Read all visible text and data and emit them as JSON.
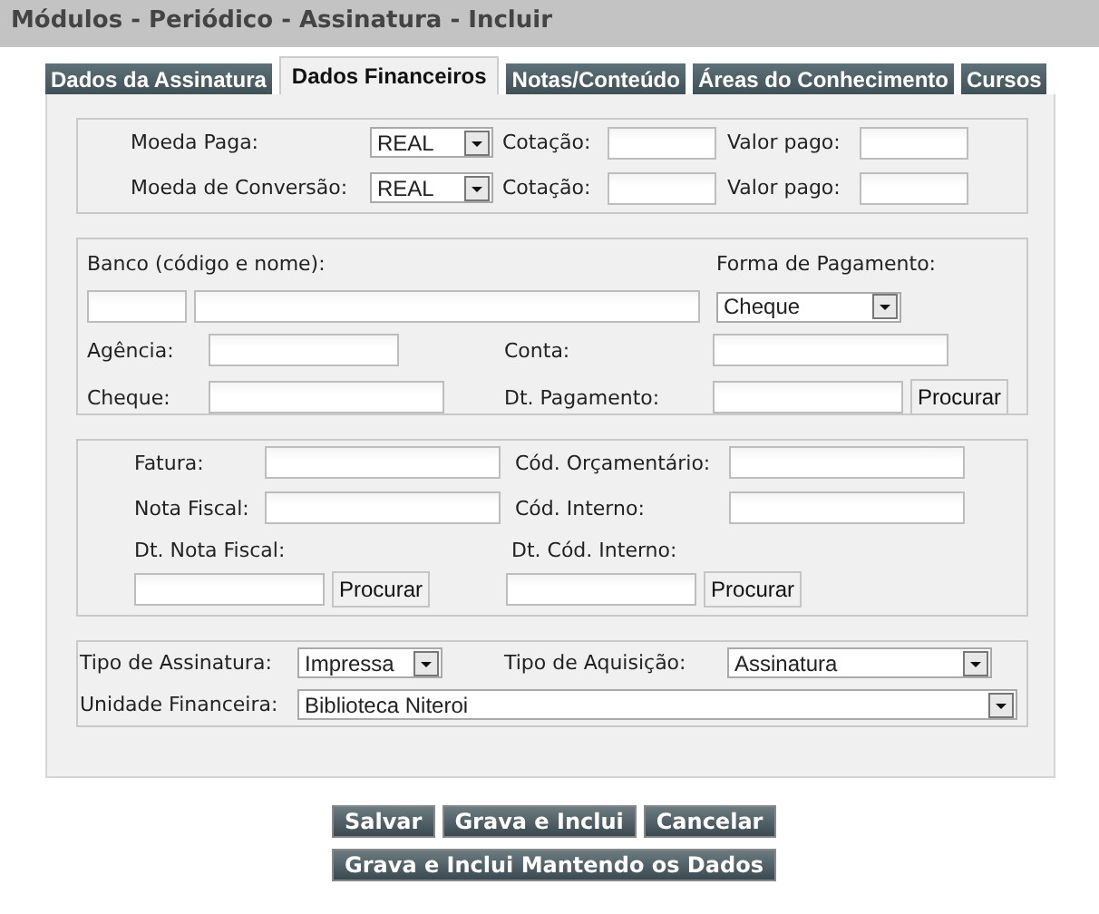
{
  "title": "Módulos - Periódico - Assinatura - Incluir",
  "tabs": [
    {
      "label": "Dados da Assinatura",
      "selected": false
    },
    {
      "label": "Dados Financeiros",
      "selected": true
    },
    {
      "label": "Notas/Conteúdo",
      "selected": false
    },
    {
      "label": "Áreas do Conhecimento",
      "selected": false
    },
    {
      "label": "Cursos",
      "selected": false
    }
  ],
  "currency_rows": [
    {
      "currency_label": "Moeda Paga:",
      "currency": "REAL",
      "rate_label": "Cotação:",
      "paid_label": "Valor pago:"
    },
    {
      "currency_label": "Moeda de Conversão:",
      "currency": "REAL",
      "rate_label": "Cotação:",
      "paid_label": "Valor pago:"
    }
  ],
  "bank": {
    "bank_label": "Banco (código e nome):",
    "payment_label": "Forma de Pagamento:",
    "payment_method": "Cheque",
    "agency_label": "Agência:",
    "account_label": "Conta:",
    "check_label": "Cheque:",
    "payment_date_label": "Dt. Pagamento:",
    "search_button": "Procurar"
  },
  "invoice": {
    "invoice_label": "Fatura:",
    "budget_code_label": "Cód. Orçamentário:",
    "tax_note_label": "Nota Fiscal:",
    "internal_code_label": "Cód. Interno:",
    "tax_note_date_label": "Dt. Nota Fiscal:",
    "internal_code_date_label": "Dt. Cód. Interno:",
    "search_buttons": [
      "Procurar",
      "Procurar"
    ]
  },
  "subscription": {
    "type_label": "Tipo de Assinatura:",
    "type": "Impressa",
    "acquisition_label": "Tipo de Aquisição:",
    "acquisition": "Assinatura",
    "unit_label": "Unidade Financeira:",
    "unit": "Biblioteca Niteroi"
  },
  "buttons": [
    [
      "Salvar",
      "Grava e Inclui",
      "Cancelar"
    ],
    [
      "Grava e Inclui Mantendo os Dados"
    ]
  ]
}
